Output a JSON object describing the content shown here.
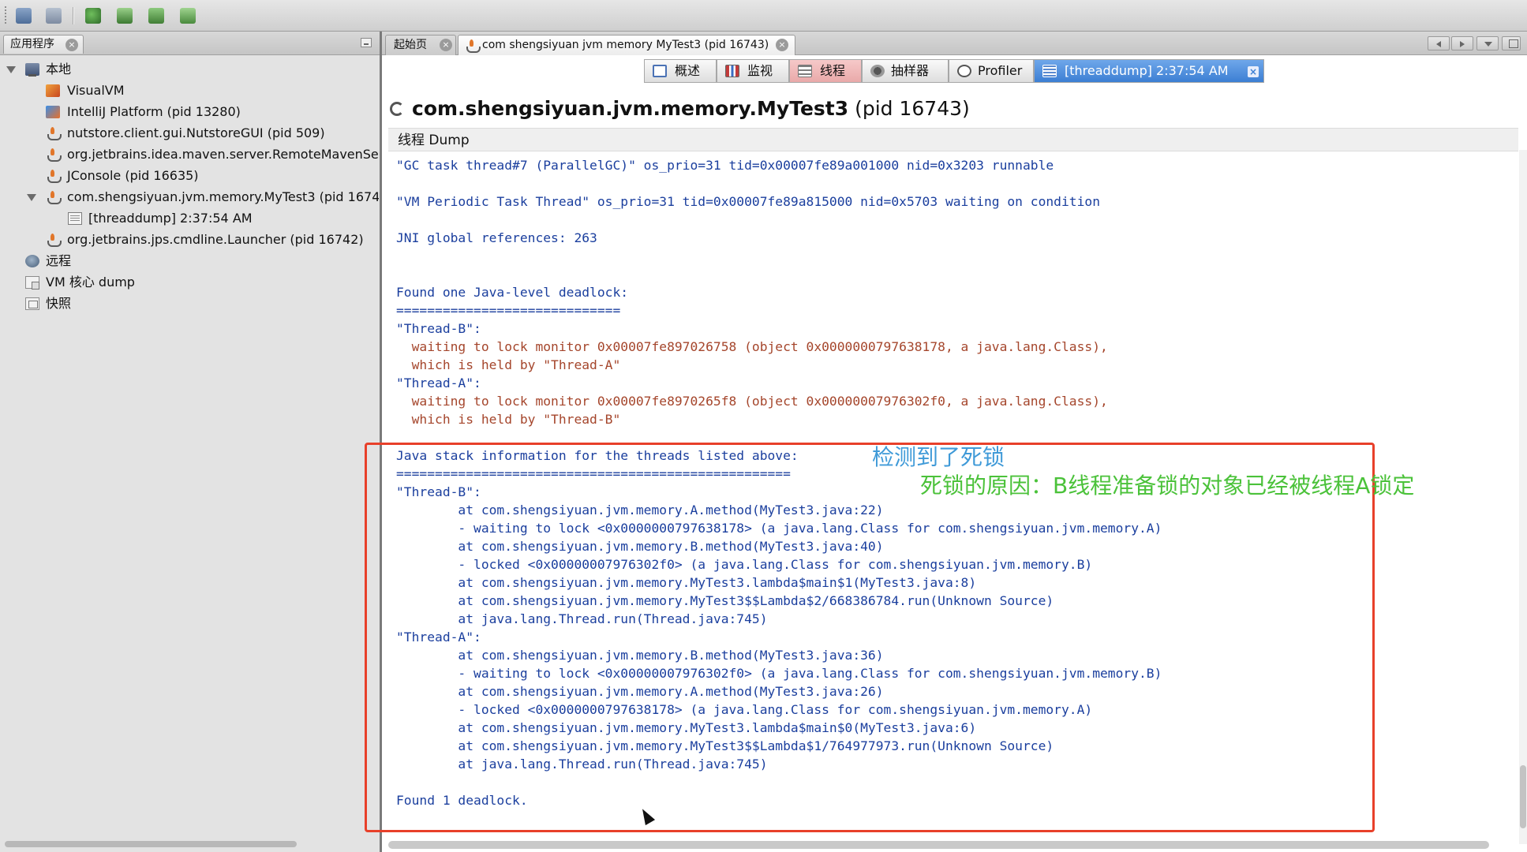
{
  "toolbar": {
    "buttons": [
      "open-file-icon",
      "save-icon",
      "add-jmx-icon",
      "add-remote-host-icon",
      "add-core-dump-icon",
      "add-snapshot-icon"
    ]
  },
  "left_panel": {
    "tab_label": "应用程序",
    "tree": [
      {
        "label": "本地",
        "icon": "host-icon"
      },
      {
        "label": "VisualVM",
        "icon": "visualvm-icon"
      },
      {
        "label": "IntelliJ Platform (pid 13280)",
        "icon": "intellij-icon"
      },
      {
        "label": "nutstore.client.gui.NutstoreGUI (pid 509)",
        "icon": "java-icon"
      },
      {
        "label": "org.jetbrains.idea.maven.server.RemoteMavenServ",
        "icon": "java-icon"
      },
      {
        "label": "JConsole (pid 16635)",
        "icon": "java-icon"
      },
      {
        "label": "com.shengsiyuan.jvm.memory.MyTest3 (pid 1674",
        "icon": "java-icon"
      },
      {
        "label": "[threaddump] 2:37:54 AM",
        "icon": "thread-dump-icon"
      },
      {
        "label": "org.jetbrains.jps.cmdline.Launcher (pid 16742)",
        "icon": "java-icon"
      },
      {
        "label": "远程",
        "icon": "remote-icon"
      },
      {
        "label": "VM 核心 dump",
        "icon": "core-dump-icon"
      },
      {
        "label": "快照",
        "icon": "snapshot-icon"
      }
    ]
  },
  "doc_tabs": [
    {
      "label": "起始页"
    },
    {
      "label": "com shengsiyuan jvm memory MyTest3 (pid 16743)"
    }
  ],
  "view_tabs": [
    {
      "label": "概述"
    },
    {
      "label": "监视"
    },
    {
      "label": "线程"
    },
    {
      "label": "抽样器"
    },
    {
      "label": "Profiler"
    },
    {
      "label": "[threaddump] 2:37:54 AM"
    }
  ],
  "header": {
    "title_bold": "com.shengsiyuan.jvm.memory.MyTest3",
    "title_pid": "(pid 16743)"
  },
  "dump_section_label": "线程 Dump",
  "dump_lines": [
    "\"GC task thread#7 (ParallelGC)\" os_prio=31 tid=0x00007fe89a001000 nid=0x3203 runnable",
    "",
    "\"VM Periodic Task Thread\" os_prio=31 tid=0x00007fe89a815000 nid=0x5703 waiting on condition",
    "",
    "JNI global references: 263",
    "",
    "",
    "Found one Java-level deadlock:",
    "=============================",
    "\"Thread-B\":",
    "  waiting to lock monitor 0x00007fe897026758 (object 0x0000000797638178, a java.lang.Class),",
    "  which is held by \"Thread-A\"",
    "\"Thread-A\":",
    "  waiting to lock monitor 0x00007fe8970265f8 (object 0x00000007976302f0, a java.lang.Class),",
    "  which is held by \"Thread-B\"",
    "",
    "Java stack information for the threads listed above:",
    "===================================================",
    "\"Thread-B\":",
    "        at com.shengsiyuan.jvm.memory.A.method(MyTest3.java:22)",
    "        - waiting to lock <0x0000000797638178> (a java.lang.Class for com.shengsiyuan.jvm.memory.A)",
    "        at com.shengsiyuan.jvm.memory.B.method(MyTest3.java:40)",
    "        - locked <0x00000007976302f0> (a java.lang.Class for com.shengsiyuan.jvm.memory.B)",
    "        at com.shengsiyuan.jvm.memory.MyTest3.lambda$main$1(MyTest3.java:8)",
    "        at com.shengsiyuan.jvm.memory.MyTest3$$Lambda$2/668386784.run(Unknown Source)",
    "        at java.lang.Thread.run(Thread.java:745)",
    "\"Thread-A\":",
    "        at com.shengsiyuan.jvm.memory.B.method(MyTest3.java:36)",
    "        - waiting to lock <0x00000007976302f0> (a java.lang.Class for com.shengsiyuan.jvm.memory.B)",
    "        at com.shengsiyuan.jvm.memory.A.method(MyTest3.java:26)",
    "        - locked <0x0000000797638178> (a java.lang.Class for com.shengsiyuan.jvm.memory.A)",
    "        at com.shengsiyuan.jvm.memory.MyTest3.lambda$main$0(MyTest3.java:6)",
    "        at com.shengsiyuan.jvm.memory.MyTest3$$Lambda$1/764977973.run(Unknown Source)",
    "        at java.lang.Thread.run(Thread.java:745)",
    "",
    "Found 1 deadlock."
  ],
  "annotations": {
    "line1": "检测到了死锁",
    "line2": "死锁的原因：B线程准备锁的对象已经被线程A锁定"
  },
  "colors": {
    "dump_blue": "#1b3f9e",
    "dump_red": "#a5462c",
    "annotation_box": "#e8402a",
    "annotation_blue": "#3f9ad8",
    "annotation_green": "#4bc23a",
    "active_view_tab": "#3c7fd3"
  }
}
